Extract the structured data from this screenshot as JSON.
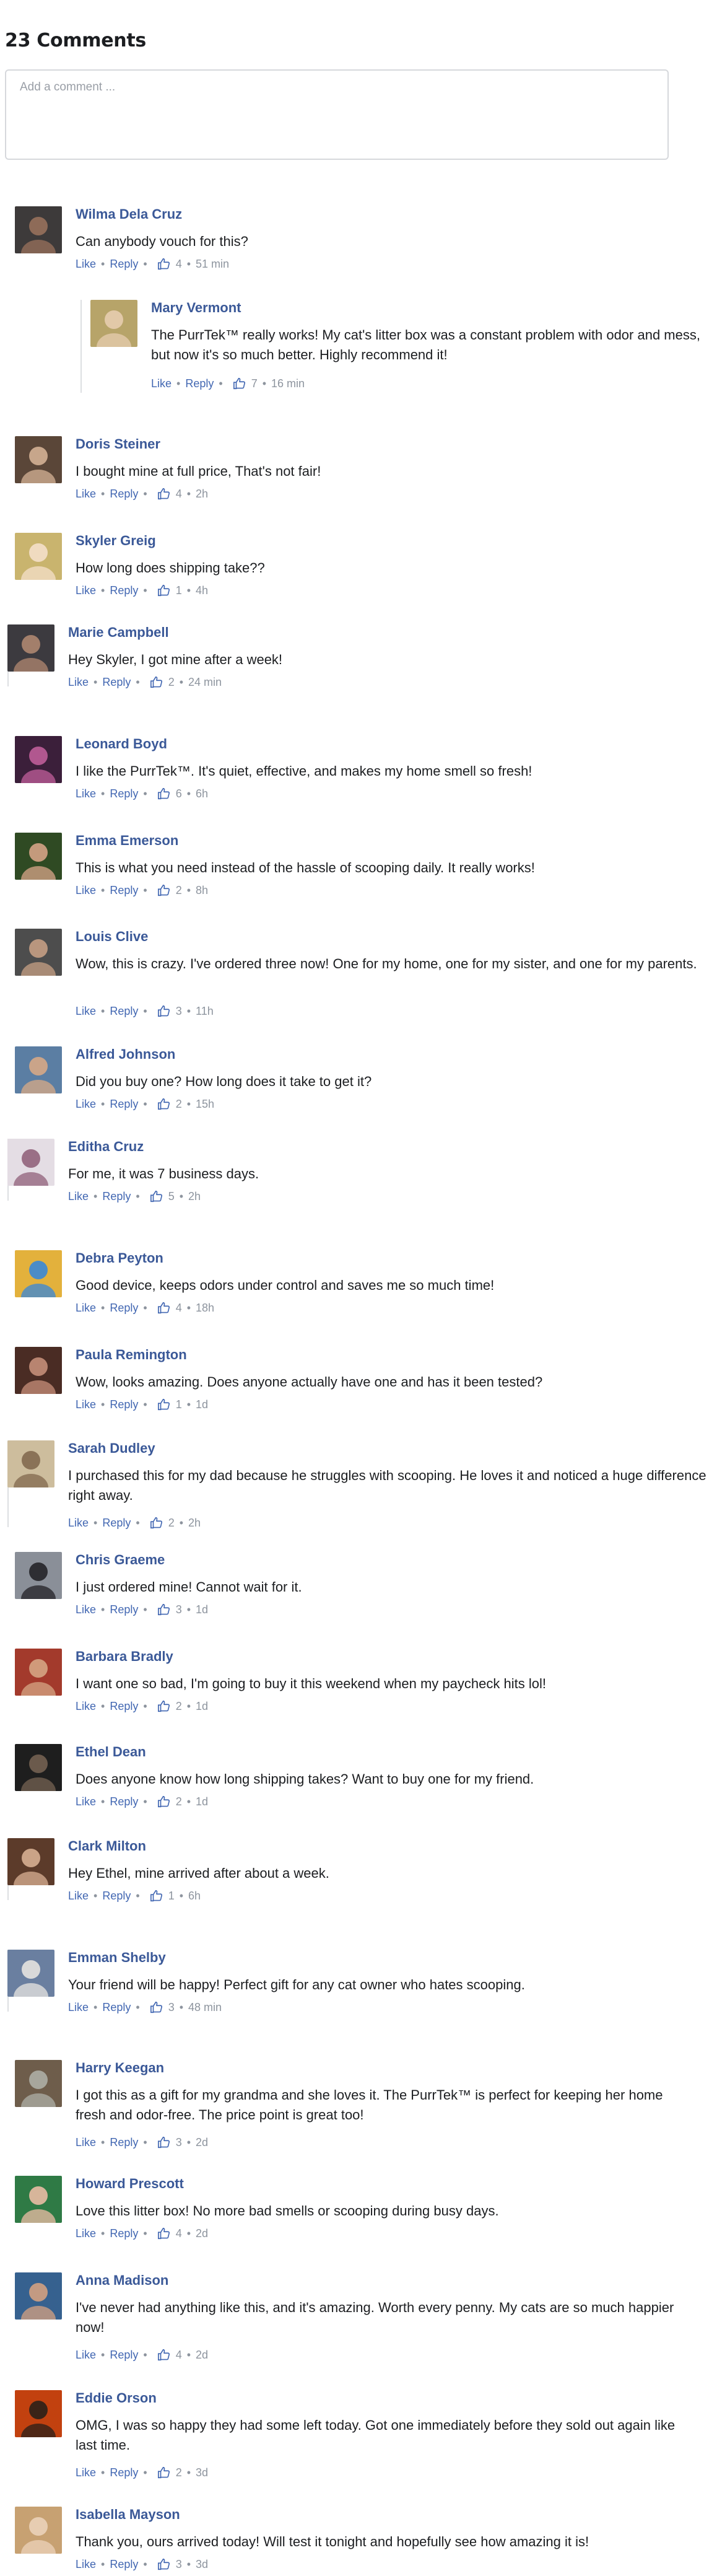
{
  "header": {
    "title": "23 Comments"
  },
  "composer": {
    "placeholder": "Add a comment ..."
  },
  "actions": {
    "like": "Like",
    "reply": "Reply"
  },
  "comments": [
    {
      "name": "Wilma Dela Cruz",
      "text": "Can anybody vouch for this?",
      "likes": "4",
      "time": "51 min",
      "avatar_colors": [
        "#3d3a3a",
        "#8e6b58"
      ]
    },
    {
      "name": "Mary Vermont",
      "text": "The PurrTek™ really works! My cat's litter box was a constant problem with odor and mess, but now it's so much better. Highly recommend it!",
      "likes": "7",
      "time": "16 min",
      "avatar_colors": [
        "#b7a469",
        "#e2c9a8"
      ]
    },
    {
      "name": "Doris Steiner",
      "text": "I bought mine at full price, That's not fair!",
      "likes": "4",
      "time": "2h",
      "avatar_colors": [
        "#5a4638",
        "#c7a68b"
      ]
    },
    {
      "name": "Skyler Greig",
      "text": "How long does shipping take??",
      "likes": "1",
      "time": "4h",
      "avatar_colors": [
        "#c9b46e",
        "#f0dbc0"
      ]
    },
    {
      "name": "Marie Campbell",
      "text": "Hey Skyler, I got mine after a week!",
      "likes": "2",
      "time": "24 min",
      "avatar_colors": [
        "#3c3a3f",
        "#a37f6b"
      ]
    },
    {
      "name": "Leonard Boyd",
      "text": "I like the PurrTek™. It's quiet, effective, and makes my home smell so fresh!",
      "likes": "6",
      "time": "6h",
      "avatar_colors": [
        "#3b1f3a",
        "#b1578f"
      ]
    },
    {
      "name": "Emma Emerson",
      "text": "This is what you need instead of the hassle of scooping daily. It really works!",
      "likes": "2",
      "time": "8h",
      "avatar_colors": [
        "#2f4a23",
        "#c49a7c"
      ]
    },
    {
      "name": "Louis Clive",
      "text": "Wow, this is crazy. I've ordered three now! One for my home, one for my sister, and one for my parents.",
      "likes": "3",
      "time": "11h",
      "avatar_colors": [
        "#4d4d4d",
        "#b9967e"
      ]
    },
    {
      "name": "Alfred Johnson",
      "text": "Did you buy one? How long does it take to get it?",
      "likes": "2",
      "time": "15h",
      "avatar_colors": [
        "#5b7ea3",
        "#caa489"
      ]
    },
    {
      "name": "Editha Cruz",
      "text": "For me, it was 7 business days.",
      "likes": "5",
      "time": "2h",
      "avatar_colors": [
        "#e4dde4",
        "#9a6f86"
      ]
    },
    {
      "name": "Debra Peyton",
      "text": "Good device, keeps odors under control and saves me so much time!",
      "likes": "4",
      "time": "18h",
      "avatar_colors": [
        "#e3b13c",
        "#4b8cc7"
      ]
    },
    {
      "name": "Paula Remington",
      "text": "Wow, looks amazing. Does anyone actually have one and has it been tested?",
      "likes": "1",
      "time": "1d",
      "avatar_colors": [
        "#4a2c24",
        "#b88470"
      ]
    },
    {
      "name": "Sarah Dudley",
      "text": "I purchased this for my dad because he struggles with scooping. He loves it and noticed a huge difference right away.",
      "likes": "2",
      "time": "2h",
      "avatar_colors": [
        "#cdbd9d",
        "#8a7257"
      ]
    },
    {
      "name": "Chris Graeme",
      "text": "I just ordered mine! Cannot wait for it.",
      "likes": "3",
      "time": "1d",
      "avatar_colors": [
        "#8a8f98",
        "#2e2e33"
      ]
    },
    {
      "name": "Barbara Bradly",
      "text": "I want one so bad, I'm going to buy it this weekend when my paycheck hits lol!",
      "likes": "2",
      "time": "1d",
      "avatar_colors": [
        "#a33a2c",
        "#d09a7a"
      ]
    },
    {
      "name": "Ethel Dean",
      "text": "Does anyone know how long shipping takes? Want to buy one for my friend.",
      "likes": "2",
      "time": "1d",
      "avatar_colors": [
        "#1e1e1e",
        "#6b5a4c"
      ]
    },
    {
      "name": "Clark Milton",
      "text": "Hey Ethel, mine arrived after about a week.",
      "likes": "1",
      "time": "6h",
      "avatar_colors": [
        "#5c3b2a",
        "#caa387"
      ]
    },
    {
      "name": "Emman Shelby",
      "text": "Your friend will be happy! Perfect gift for any cat owner who hates scooping.",
      "likes": "3",
      "time": "48 min",
      "avatar_colors": [
        "#6a7fa0",
        "#d9d9d9"
      ]
    },
    {
      "name": "Harry Keegan",
      "text": "I got this as a gift for my grandma and she loves it. The PurrTek™ is perfect for keeping her home fresh and odor-free. The price point is great too!",
      "likes": "3",
      "time": "2d",
      "avatar_colors": [
        "#6e5d4b",
        "#a7a69c"
      ]
    },
    {
      "name": "Howard Prescott",
      "text": "Love this litter box! No more bad smells or scooping during busy days.",
      "likes": "4",
      "time": "2d",
      "avatar_colors": [
        "#2f7a45",
        "#d7b59a"
      ]
    },
    {
      "name": "Anna Madison",
      "text": "I've never had anything like this, and it's amazing. Worth every penny. My cats are so much happier now!",
      "likes": "4",
      "time": "2d",
      "avatar_colors": [
        "#36618f",
        "#c39a82"
      ]
    },
    {
      "name": "Eddie Orson",
      "text": "OMG, I was so happy they had some left today. Got one immediately before they sold out again like last time.",
      "likes": "2",
      "time": "3d",
      "avatar_colors": [
        "#c2410f",
        "#3a2317"
      ]
    },
    {
      "name": "Isabella Mayson",
      "text": "Thank you, ours arrived today! Will test it tonight and hopefully see how amazing it is!",
      "likes": "3",
      "time": "3d",
      "avatar_colors": [
        "#c7a172",
        "#e7cdb2"
      ]
    }
  ]
}
